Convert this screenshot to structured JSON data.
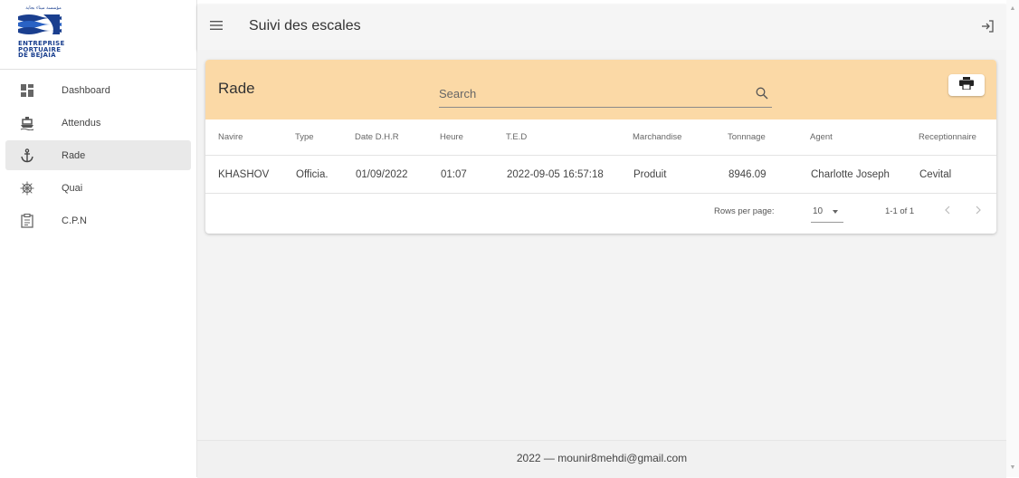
{
  "logo": {
    "arabic_text": "مؤسسة ميناء بجاية",
    "brand_lines": [
      "ENTREPRISE",
      "PORTUAIRE",
      "DE BEJAIA"
    ]
  },
  "sidebar": {
    "items": [
      {
        "label": "Dashboard",
        "icon": "dashboard-icon"
      },
      {
        "label": "Attendus",
        "icon": "ship-icon"
      },
      {
        "label": "Rade",
        "icon": "anchor-icon",
        "active": true
      },
      {
        "label": "Quai",
        "icon": "helm-wheel-icon"
      },
      {
        "label": "C.P.N",
        "icon": "clipboard-icon"
      }
    ]
  },
  "header": {
    "title": "Suivi des escales",
    "menu_icon": "menu-icon",
    "logout_icon": "logout-icon"
  },
  "card": {
    "title": "Rade",
    "search_placeholder": "Search",
    "print_icon": "print-icon",
    "header_color": "#fbd9a6"
  },
  "table": {
    "columns": [
      "Navire",
      "Type",
      "Date D.H.R",
      "Heure",
      "T.E.D",
      "Marchandise",
      "Tonnnage",
      "Agent",
      "Receptionnaire"
    ],
    "rows": [
      [
        "KHASHOV",
        "Officia.",
        "01/09/2022",
        "01:07",
        "2022-09-05 16:57:18",
        "Produit",
        "8946.09",
        "Charlotte Joseph",
        "Cevital"
      ]
    ]
  },
  "pagination": {
    "rows_per_page_label": "Rows per page:",
    "rows_per_page_value": "10",
    "range": "1-1 of 1"
  },
  "footer": {
    "text": "2022 — mounir8mehdi@gmail.com"
  }
}
